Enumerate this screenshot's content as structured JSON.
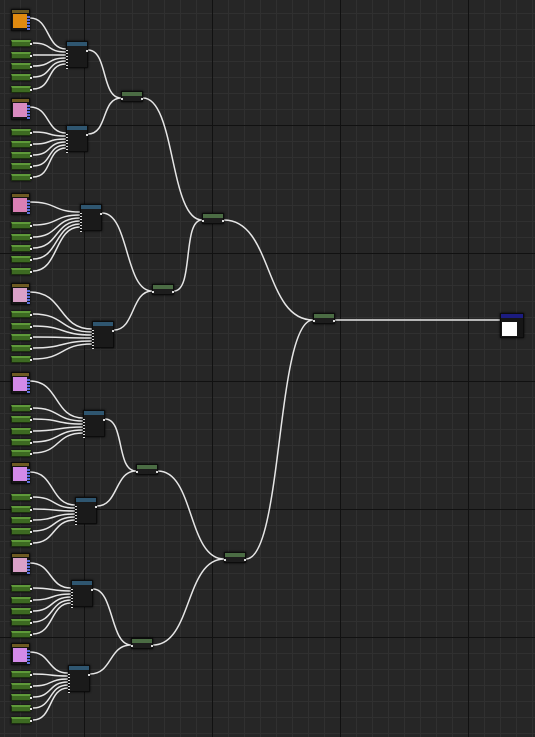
{
  "canvas": {
    "background": "#262626",
    "wire_color": "#e6e6e6"
  },
  "colors": {
    "orange": "#e08a10",
    "pink": "#d98ac0",
    "dusty_pink": "#d97fb4",
    "light_pink": "#d9a0c8",
    "violet": "#d38ae8",
    "white": "#ffffff"
  },
  "swatch_colors": [
    "#e08a10",
    "#d98ac0",
    "#d97fb4",
    "#d9a0c8",
    "#d38ae8",
    "#d38ae8",
    "#d9a0c8",
    "#d38ae8"
  ],
  "icons": [
    "color-node-icon",
    "parameter-node-icon",
    "group-node-icon",
    "merge-node-icon",
    "output-node-icon"
  ]
}
